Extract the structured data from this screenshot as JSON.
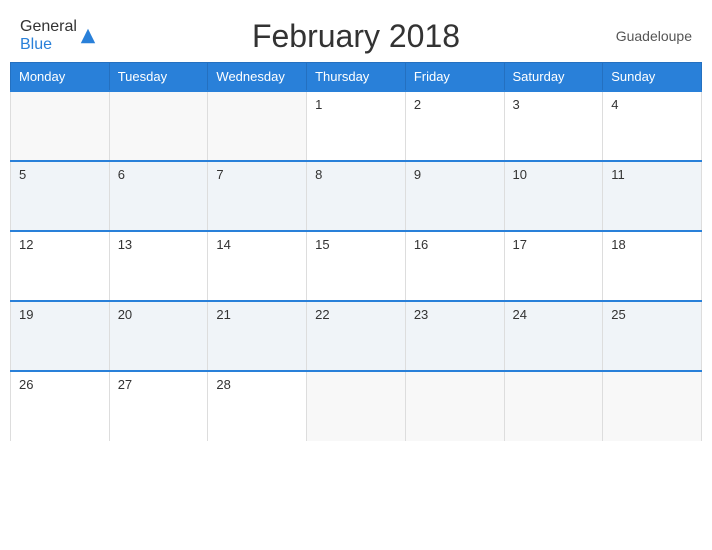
{
  "header": {
    "title": "February 2018",
    "region": "Guadeloupe",
    "logo_general": "General",
    "logo_blue": "Blue"
  },
  "calendar": {
    "weekdays": [
      "Monday",
      "Tuesday",
      "Wednesday",
      "Thursday",
      "Friday",
      "Saturday",
      "Sunday"
    ],
    "weeks": [
      [
        {
          "day": "",
          "empty": true
        },
        {
          "day": "",
          "empty": true
        },
        {
          "day": "",
          "empty": true
        },
        {
          "day": "1",
          "empty": false
        },
        {
          "day": "2",
          "empty": false
        },
        {
          "day": "3",
          "empty": false
        },
        {
          "day": "4",
          "empty": false
        }
      ],
      [
        {
          "day": "5",
          "empty": false
        },
        {
          "day": "6",
          "empty": false
        },
        {
          "day": "7",
          "empty": false
        },
        {
          "day": "8",
          "empty": false
        },
        {
          "day": "9",
          "empty": false
        },
        {
          "day": "10",
          "empty": false
        },
        {
          "day": "11",
          "empty": false
        }
      ],
      [
        {
          "day": "12",
          "empty": false
        },
        {
          "day": "13",
          "empty": false
        },
        {
          "day": "14",
          "empty": false
        },
        {
          "day": "15",
          "empty": false
        },
        {
          "day": "16",
          "empty": false
        },
        {
          "day": "17",
          "empty": false
        },
        {
          "day": "18",
          "empty": false
        }
      ],
      [
        {
          "day": "19",
          "empty": false
        },
        {
          "day": "20",
          "empty": false
        },
        {
          "day": "21",
          "empty": false
        },
        {
          "day": "22",
          "empty": false
        },
        {
          "day": "23",
          "empty": false
        },
        {
          "day": "24",
          "empty": false
        },
        {
          "day": "25",
          "empty": false
        }
      ],
      [
        {
          "day": "26",
          "empty": false
        },
        {
          "day": "27",
          "empty": false
        },
        {
          "day": "28",
          "empty": false
        },
        {
          "day": "",
          "empty": true
        },
        {
          "day": "",
          "empty": true
        },
        {
          "day": "",
          "empty": true
        },
        {
          "day": "",
          "empty": true
        }
      ]
    ]
  }
}
